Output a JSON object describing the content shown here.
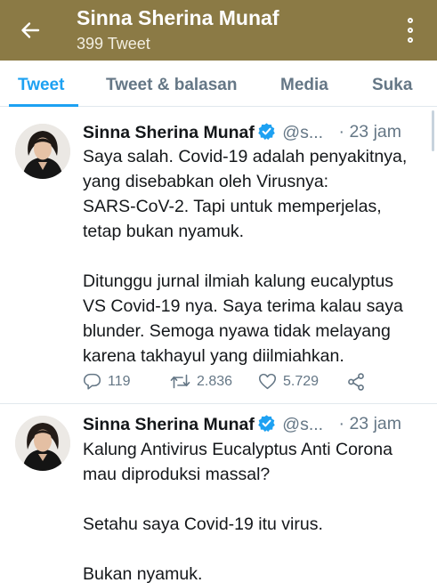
{
  "header": {
    "title": "Sinna Sherina Munaf",
    "subtitle": "399 Tweet",
    "colors": {
      "background": "#8b7a45",
      "text": "#ffffff"
    }
  },
  "tabs": [
    {
      "label": "Tweet",
      "active": true
    },
    {
      "label": "Tweet & balasan",
      "active": false
    },
    {
      "label": "Media",
      "active": false
    },
    {
      "label": "Suka",
      "active": false
    }
  ],
  "tweets": [
    {
      "name": "Sinna Sherina Munaf",
      "handle": "@s...",
      "time": "· 23 jam",
      "lines": [
        "Saya salah. Covid-19 adalah penyakitnya,",
        "yang disebabkan oleh Virusnya:",
        "SARS-CoV-2. Tapi untuk memperjelas,",
        "tetap bukan nyamuk.",
        "",
        "Ditunggu jurnal ilmiah kalung eucalyptus",
        "VS Covid-19 nya. Saya terima kalau saya",
        "blunder. Semoga nyawa tidak melayang",
        "karena takhayul yang diilmiahkan."
      ],
      "replies": "119",
      "retweets": "2.836",
      "likes": "5.729"
    },
    {
      "name": "Sinna Sherina Munaf",
      "handle": "@s...",
      "time": "· 23 jam",
      "lines": [
        "Kalung Antivirus Eucalyptus Anti Corona",
        "mau diproduksi massal?",
        "",
        "Setahu saya Covid-19 itu virus.",
        "",
        "Bukan nyamuk."
      ]
    }
  ],
  "icons": {
    "back": "arrow-left-icon",
    "more": "more-vertical-icon",
    "verified": "verified-badge-icon",
    "reply": "reply-icon",
    "retweet": "retweet-icon",
    "like": "heart-icon",
    "share": "share-icon"
  },
  "colors": {
    "accent": "#1da1f2",
    "muted": "#657786",
    "divider": "#e1e8ed"
  }
}
